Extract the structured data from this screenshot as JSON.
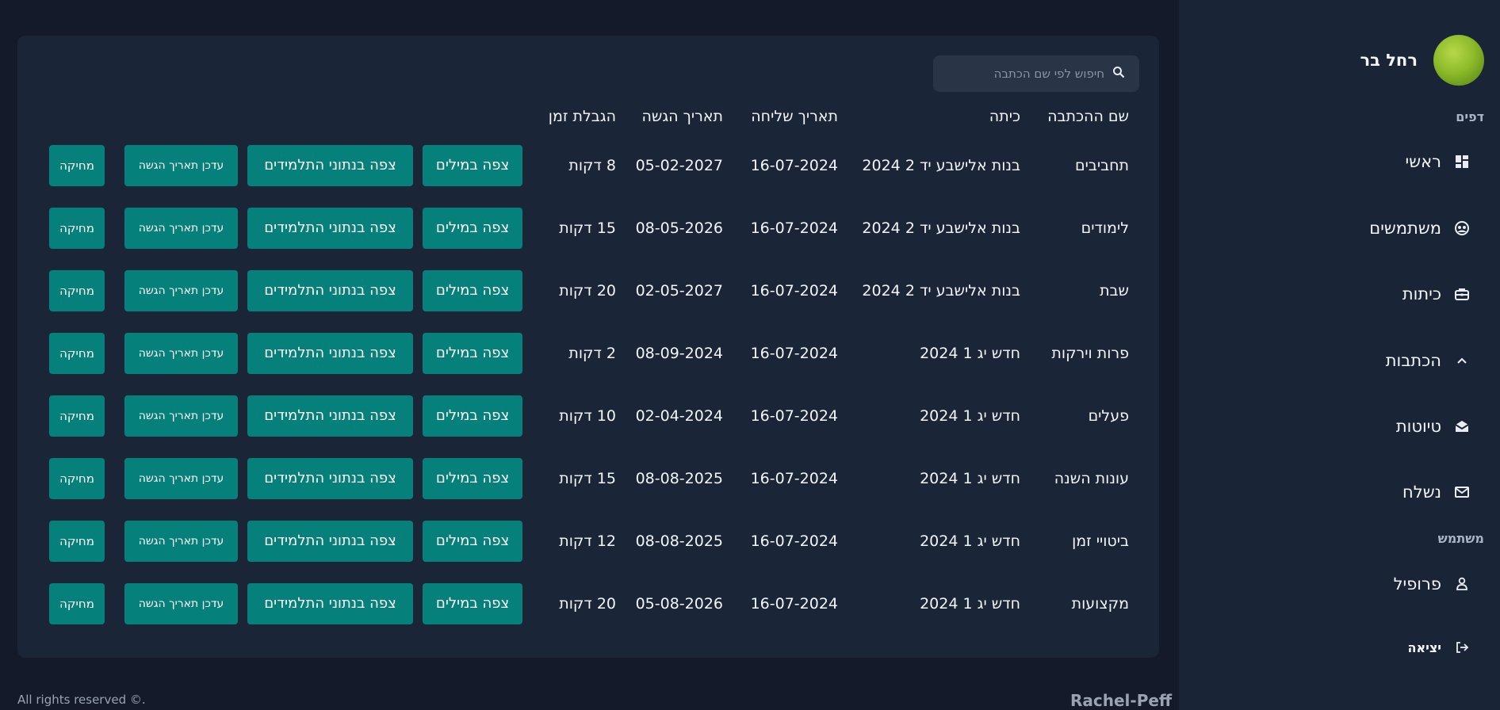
{
  "user": {
    "name": "רחל בר"
  },
  "sidebar": {
    "pages_title": "דפים",
    "items": [
      {
        "label": "ראשי",
        "icon": "dashboard-icon"
      },
      {
        "label": "משתמשים",
        "icon": "users-icon"
      },
      {
        "label": "כיתות",
        "icon": "briefcase-icon"
      },
      {
        "label": "הכתבות",
        "icon": "chevron-up-icon"
      },
      {
        "label": "טיוטות",
        "icon": "drafts-icon"
      },
      {
        "label": "נשלח",
        "icon": "mail-icon"
      }
    ],
    "user_title": "משתמש",
    "profile": {
      "label": "פרופיל",
      "icon": "person-icon"
    },
    "logout": {
      "label": "יציאה",
      "icon": "logout-icon"
    }
  },
  "search": {
    "placeholder": "חיפוש לפי שם הכתבה"
  },
  "table": {
    "headers": {
      "name": "שם ההכתבה",
      "class": "כיתה",
      "sent": "תאריך שליחה",
      "due": "תאריך הגשה",
      "limit": "הגבלת זמן"
    },
    "buttons": {
      "view_words": "צפה במילים",
      "view_students": "צפה בנתוני התלמידים",
      "update_date": "עדכן תאריך הגשה",
      "delete": "מחיקה"
    },
    "rows": [
      {
        "name": "תחביבים",
        "class": "בנות אלישבע יד 2 2024",
        "sent": "16-07-2024",
        "due": "05-02-2027",
        "limit": "8 דקות"
      },
      {
        "name": "לימודים",
        "class": "בנות אלישבע יד 2 2024",
        "sent": "16-07-2024",
        "due": "08-05-2026",
        "limit": "15 דקות"
      },
      {
        "name": "שבת",
        "class": "בנות אלישבע יד 2 2024",
        "sent": "16-07-2024",
        "due": "02-05-2027",
        "limit": "20 דקות"
      },
      {
        "name": "פרות וירקות",
        "class": "חדש יג 1 2024",
        "sent": "16-07-2024",
        "due": "08-09-2024",
        "limit": "2 דקות"
      },
      {
        "name": "פעלים",
        "class": "חדש יג 1 2024",
        "sent": "16-07-2024",
        "due": "02-04-2024",
        "limit": "10 דקות"
      },
      {
        "name": "עונות השנה",
        "class": "חדש יג 1 2024",
        "sent": "16-07-2024",
        "due": "08-08-2025",
        "limit": "15 דקות"
      },
      {
        "name": "ביטויי זמן",
        "class": "חדש יג 1 2024",
        "sent": "16-07-2024",
        "due": "08-08-2025",
        "limit": "12 דקות"
      },
      {
        "name": "מקצועות",
        "class": "חדש יג 1 2024",
        "sent": "16-07-2024",
        "due": "05-08-2026",
        "limit": "20 דקות"
      }
    ]
  },
  "footer": {
    "brand": "Rachel-Peff",
    "copyright": "All rights reserved ©."
  },
  "colors": {
    "background": "#141a29",
    "sidebar": "#1a2437",
    "card": "#1b2538",
    "button": "#06807b"
  }
}
